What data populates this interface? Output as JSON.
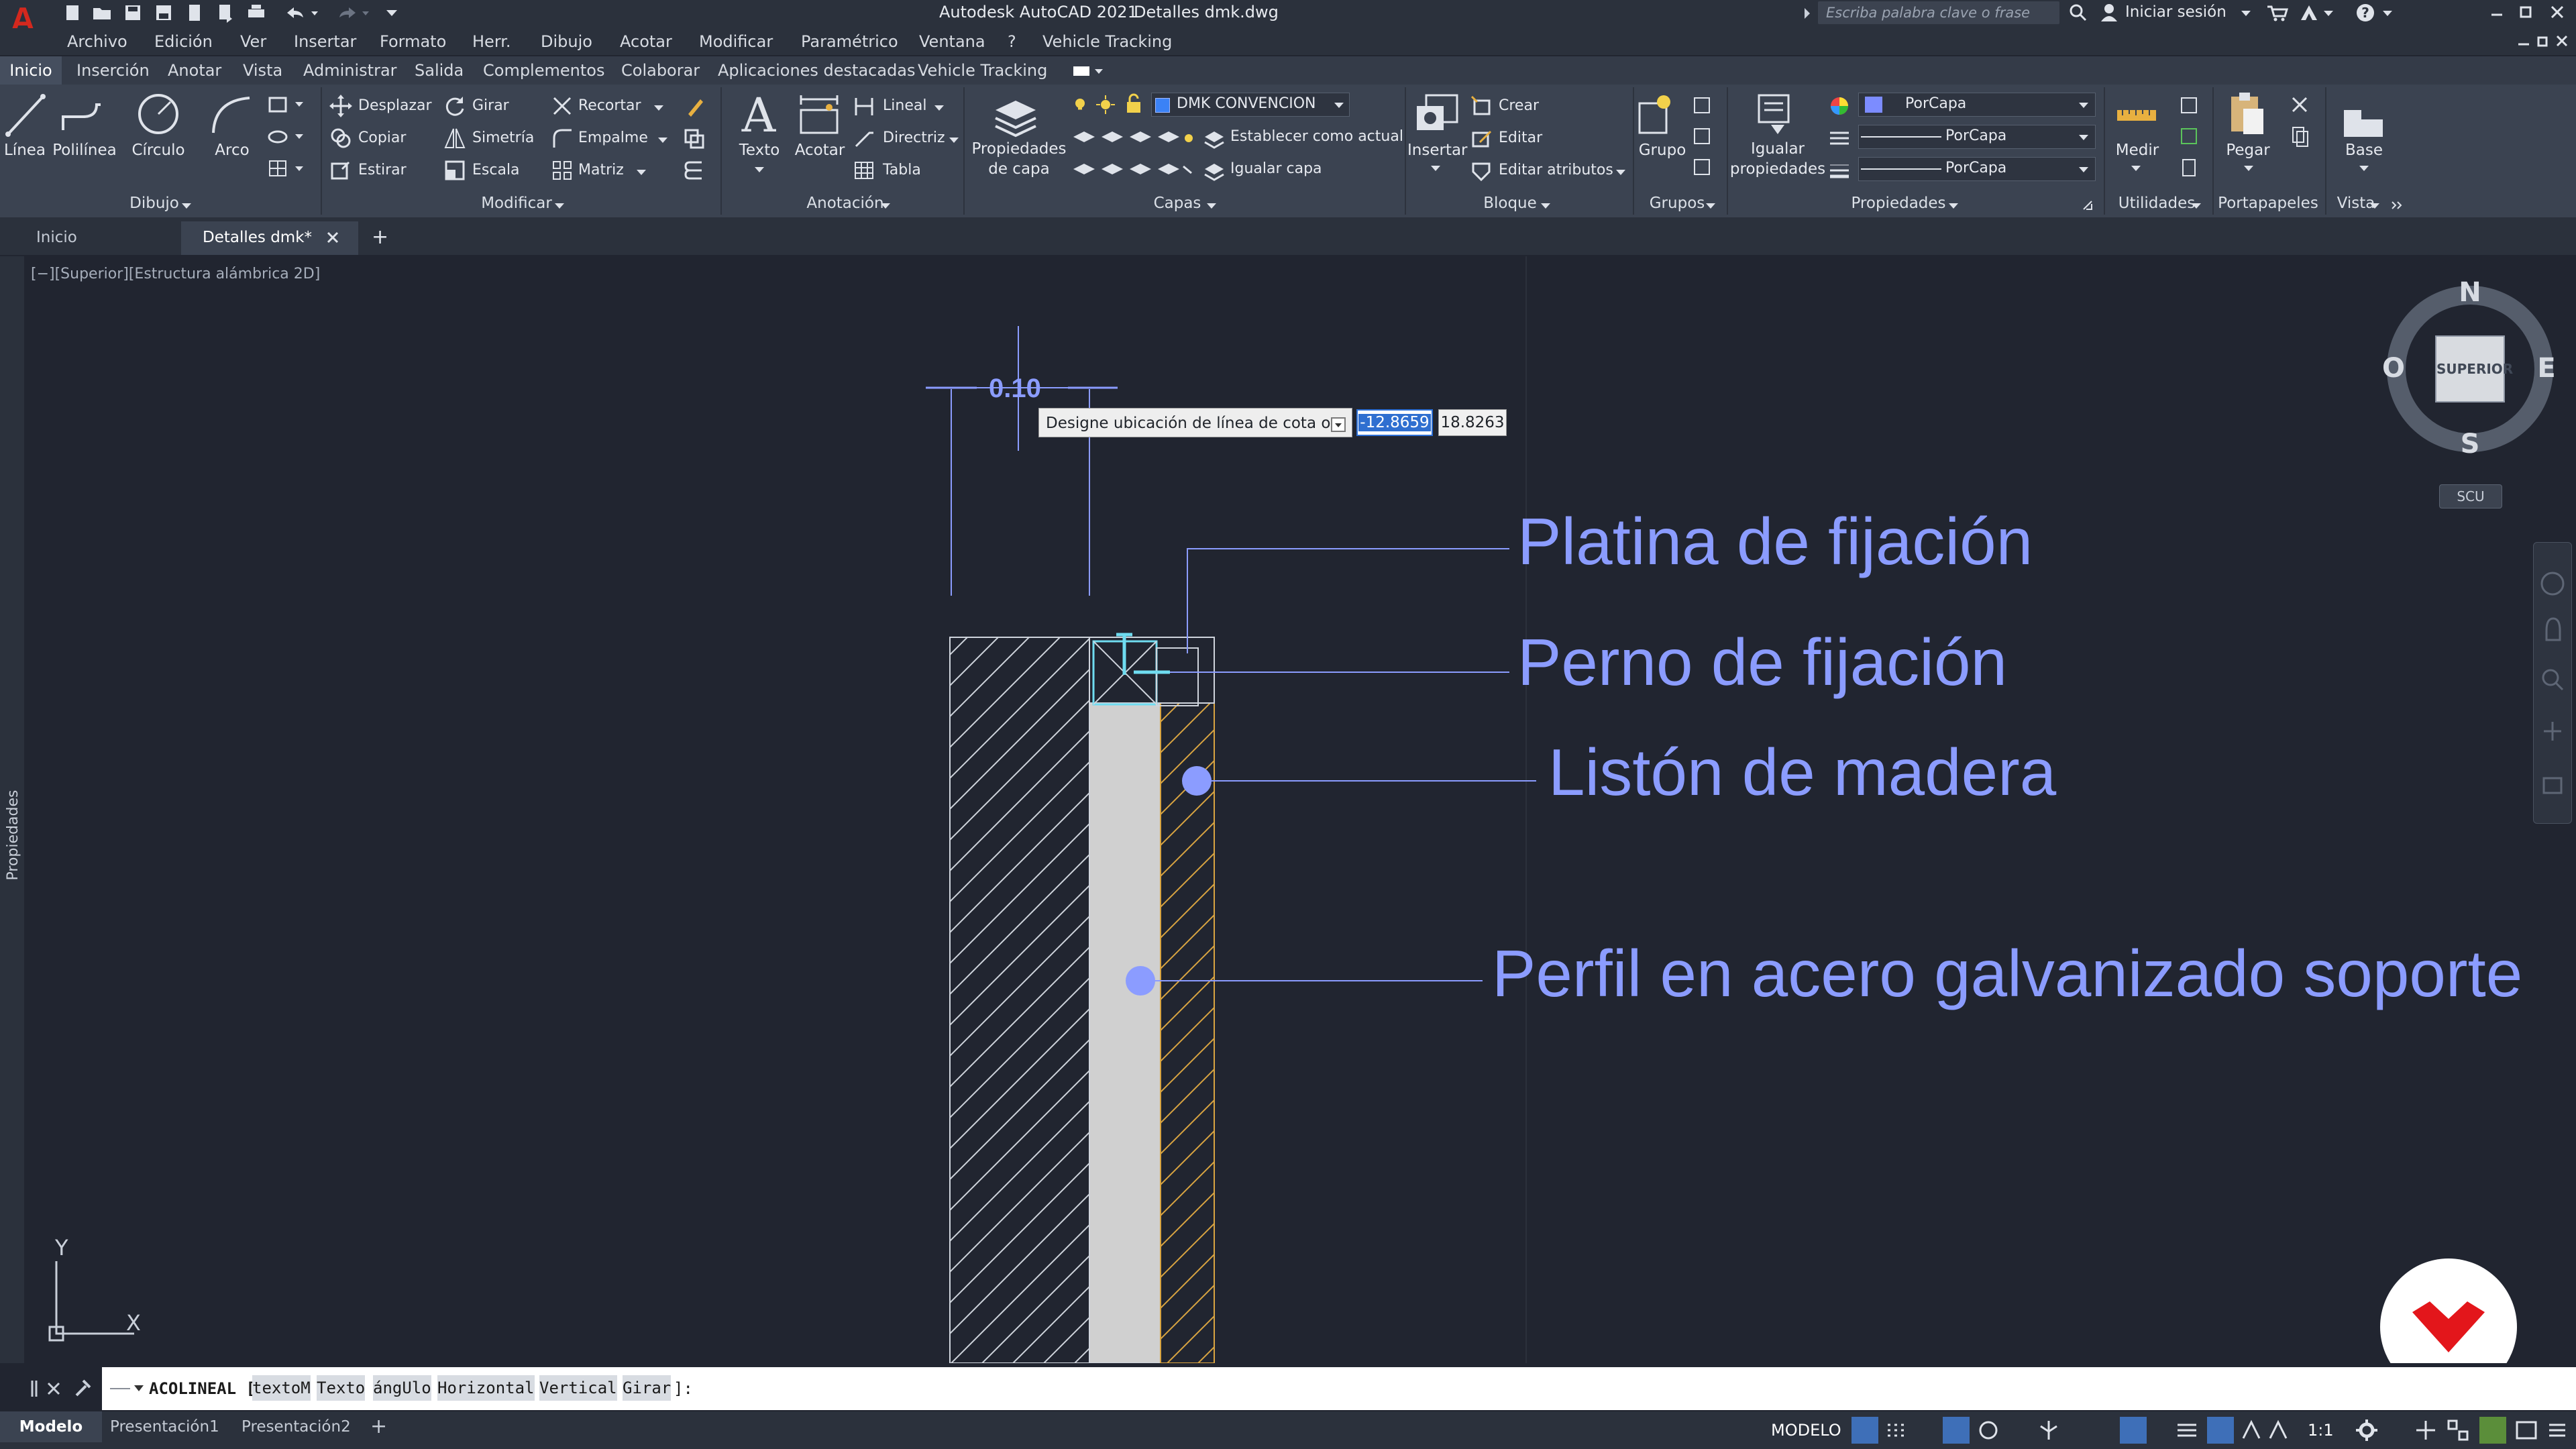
{
  "titlebar": {
    "app_title": "Autodesk AutoCAD 2021",
    "file_name": "Detalles dmk.dwg",
    "search_placeholder": "Escriba palabra clave o frase",
    "signin": "Iniciar sesión",
    "logo_letter": "A"
  },
  "menu": {
    "items": [
      "Archivo",
      "Edición",
      "Ver",
      "Insertar",
      "Formato",
      "Herr.",
      "Dibujo",
      "Acotar",
      "Modificar",
      "Paramétrico",
      "Ventana",
      "?",
      "Vehicle Tracking"
    ]
  },
  "ribbon_tabs": {
    "items": [
      "Inicio",
      "Inserción",
      "Anotar",
      "Vista",
      "Administrar",
      "Salida",
      "Complementos",
      "Colaborar",
      "Aplicaciones destacadas",
      "Vehicle Tracking"
    ]
  },
  "ribbon": {
    "dibujo": {
      "title": "Dibujo",
      "linea": "Línea",
      "polilinea": "Polilínea",
      "circulo": "Círculo",
      "arco": "Arco"
    },
    "modificar": {
      "title": "Modificar",
      "desplazar": "Desplazar",
      "girar": "Girar",
      "recortar": "Recortar",
      "copiar": "Copiar",
      "simetria": "Simetría",
      "empalme": "Empalme",
      "estirar": "Estirar",
      "escala": "Escala",
      "matriz": "Matriz"
    },
    "anotacion": {
      "title": "Anotación",
      "texto": "Texto",
      "acotar": "Acotar",
      "lineal": "Lineal",
      "directriz": "Directriz",
      "tabla": "Tabla"
    },
    "capas": {
      "title": "Capas",
      "propiedades_line1": "Propiedades",
      "propiedades_line2": "de capa",
      "current_layer": "DMK CONVENCION",
      "establecer": "Establecer como actual",
      "igualar": "Igualar capa"
    },
    "bloque": {
      "title": "Bloque",
      "insertar": "Insertar",
      "crear": "Crear",
      "editar": "Editar",
      "editar_atributos": "Editar atributos"
    },
    "grupos": {
      "title": "Grupos",
      "grupo": "Grupo"
    },
    "propiedades": {
      "title": "Propiedades",
      "igualar_line1": "Igualar",
      "igualar_line2": "propiedades",
      "color": "PorCapa",
      "linetype": "PorCapa",
      "lineweight": "PorCapa"
    },
    "utilidades": {
      "title": "Utilidades",
      "medir": "Medir"
    },
    "portapapeles": {
      "title": "Portapapeles",
      "pegar": "Pegar"
    },
    "vista": {
      "title": "Vista",
      "base": "Base"
    }
  },
  "file_tabs": {
    "home": "Inicio",
    "active": "Detalles dmk*",
    "add": "+"
  },
  "viewport": {
    "label": "[−][Superior][Estructura alámbrica 2D]",
    "palette": "Propiedades"
  },
  "dynamic_input": {
    "prompt": "Designe ubicación de línea de cota o",
    "x_value": "-12.8659",
    "y_value": "18.8263"
  },
  "drawing": {
    "dimension": "0.10",
    "labels": [
      "Platina de fijación",
      "Perno de fijación",
      "Listón de madera",
      "Perfil en acero galvanizado soporte"
    ],
    "colors": {
      "annotation": "#8b9cff",
      "hatch": "#cfd4dc",
      "wood_hatch": "#d9a441",
      "profile_fill": "#d0d0d0"
    }
  },
  "viewcube": {
    "north": "N",
    "south": "S",
    "east": "E",
    "west": "O",
    "face": "SUPERIOR",
    "ucs": "SCU"
  },
  "ucs_axes": {
    "x": "X",
    "y": "Y"
  },
  "command": {
    "prefix": "ACOLINEAL [",
    "options": [
      "textoM",
      "Texto",
      "ángUlo",
      "Horizontal",
      "Vertical",
      "Girar"
    ],
    "suffix": "]:"
  },
  "layout_tabs": [
    "Modelo",
    "Presentación1",
    "Presentación2",
    "+"
  ],
  "status": {
    "space": "MODELO",
    "scale": "1:1"
  }
}
